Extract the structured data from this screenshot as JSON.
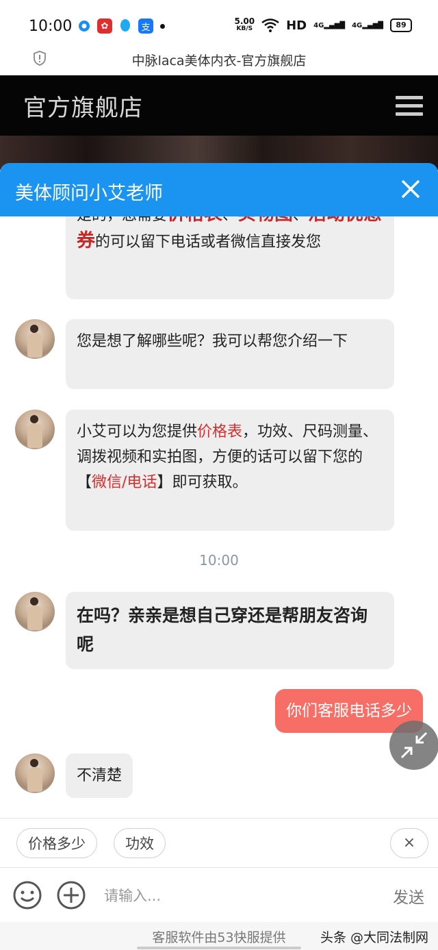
{
  "status_bar": {
    "time": "10:00",
    "net_speed_value": "5.00",
    "net_speed_unit": "KB/S",
    "hd_label": "HD",
    "signal1": "4G",
    "signal2": "4G",
    "battery": "89"
  },
  "url_bar": {
    "title": "中脉laca美体内衣-官方旗舰店"
  },
  "store": {
    "title": "官方旗舰店"
  },
  "chat": {
    "header_title": "美体顾问小艾老师",
    "messages": [
      {
        "partial_top_normal": "是的，您需要",
        "hl1": "价格表",
        "sep1": "、",
        "hl2": "实物图",
        "sep2": "、",
        "hl3": "活",
        "hl4": "动优惠券",
        "rest": "的可以留下电话或者微信直接发您"
      },
      {
        "text": "您是想了解哪些呢？我可以帮您介绍一下"
      },
      {
        "pre": "小艾可以为您提供",
        "hl": "价格表",
        "mid": "，功效、尺码测量、调拨视频和实拍图，方便的话可以留下您的【",
        "hl2": "微信/电话",
        "post": "】即可获取。"
      },
      {
        "text": "在吗？亲亲是想自己穿还是帮朋友咨询呢"
      },
      {
        "text": "你们客服电话多少"
      },
      {
        "text": "不清楚"
      }
    ],
    "timestamp": "10:00"
  },
  "quick_replies": [
    "价格多少",
    "功效"
  ],
  "input": {
    "placeholder": "请输入...",
    "send_label": "发送"
  },
  "footer": {
    "powered_by": "客服软件由53快服提供",
    "watermark": "头条 @大同法制网"
  },
  "colors": {
    "accent": "#1b93f0",
    "outgoing": "#f66e66",
    "highlight": "#d23030"
  }
}
